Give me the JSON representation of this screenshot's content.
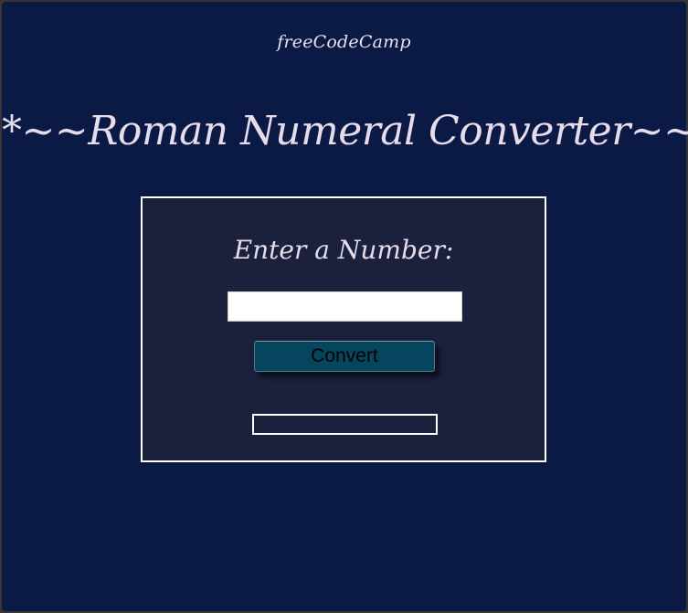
{
  "header": {
    "logo_text": "freeCodeCamp"
  },
  "main": {
    "title": "*~~Roman Numeral Converter~~*"
  },
  "converter": {
    "prompt": "Enter a Number:",
    "input_value": "",
    "input_placeholder": "",
    "convert_label": "Convert",
    "output_text": ""
  },
  "colors": {
    "background": "#0a1a45",
    "panel": "#1b203d",
    "button": "#05455e",
    "text": "#e6dcec"
  }
}
